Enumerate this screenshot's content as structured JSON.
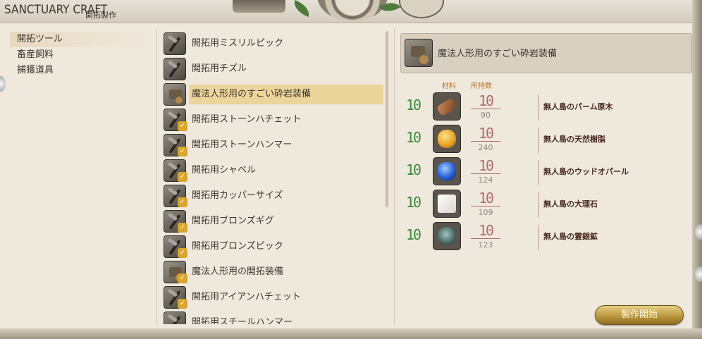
{
  "window": {
    "title": "SANCTUARY CRAFT",
    "subtitle": "開拓製作"
  },
  "categories": [
    {
      "label": "開拓ツール",
      "active": true
    },
    {
      "label": "畜産飼料",
      "active": false
    },
    {
      "label": "捕獲道具",
      "active": false
    }
  ],
  "recipes": [
    {
      "label": "開拓用ミスリルピック",
      "icon": "pickaxe-icon",
      "crafted": false,
      "selected": false
    },
    {
      "label": "開拓用チズル",
      "icon": "chisel-icon",
      "crafted": false,
      "selected": false
    },
    {
      "label": "魔法人形用のすごい砕岩装備",
      "icon": "golem-gear-icon",
      "crafted": false,
      "selected": true
    },
    {
      "label": "開拓用ストーンハチェット",
      "icon": "hatchet-icon",
      "crafted": true,
      "selected": false
    },
    {
      "label": "開拓用ストーンハンマー",
      "icon": "hammer-icon",
      "crafted": true,
      "selected": false
    },
    {
      "label": "開拓用シャベル",
      "icon": "shovel-icon",
      "crafted": true,
      "selected": false
    },
    {
      "label": "開拓用カッパーサイズ",
      "icon": "scythe-icon",
      "crafted": true,
      "selected": false
    },
    {
      "label": "開拓用ブロンズギグ",
      "icon": "gig-icon",
      "crafted": true,
      "selected": false
    },
    {
      "label": "開拓用ブロンズピック",
      "icon": "pickaxe-icon",
      "crafted": true,
      "selected": false
    },
    {
      "label": "魔法人形用の開拓装備",
      "icon": "golem-gear-icon",
      "crafted": true,
      "selected": false
    },
    {
      "label": "開拓用アイアンハチェット",
      "icon": "hatchet-icon",
      "crafted": true,
      "selected": false
    },
    {
      "label": "開拓用スチールハンマー",
      "icon": "hammer-icon",
      "crafted": false,
      "selected": false
    }
  ],
  "selected_item": {
    "name": "魔法人形用のすごい砕岩装備",
    "icon": "golem-gear-icon"
  },
  "materials_header": {
    "required": "材料",
    "owned": "所持数"
  },
  "materials": [
    {
      "required": "10",
      "have": "10",
      "owned": "90",
      "name": "無人島のパーム原木",
      "icon": "palm-log-icon",
      "color": "#8a4e2a"
    },
    {
      "required": "10",
      "have": "10",
      "owned": "240",
      "name": "無人島の天然樹脂",
      "icon": "resin-icon",
      "color": "#e8a52a"
    },
    {
      "required": "10",
      "have": "10",
      "owned": "124",
      "name": "無人島のウッドオパール",
      "icon": "opal-icon",
      "color": "#2a5ed6"
    },
    {
      "required": "10",
      "have": "10",
      "owned": "109",
      "name": "無人島の大理石",
      "icon": "marble-icon",
      "color": "#e9e7e2"
    },
    {
      "required": "10",
      "have": "10",
      "owned": "123",
      "name": "無人島の霊銀鉱",
      "icon": "ore-icon",
      "color": "#4f6b6a"
    }
  ],
  "craft_button": {
    "label": "製作開始"
  },
  "colors": {
    "accent_gold": "#ecd59a",
    "required_green": "#3c8a3c",
    "have_red": "#b26b6b",
    "header_orange": "#b8762d"
  }
}
